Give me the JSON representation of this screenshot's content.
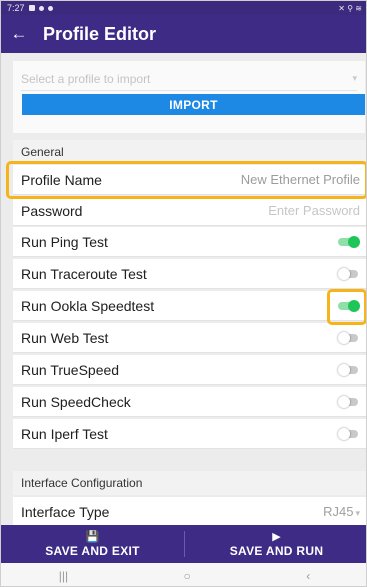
{
  "status_bar": {
    "time": "7:27",
    "right_icons": "✕ ⚲ ≋"
  },
  "app_bar": {
    "back_icon": "←",
    "title": "Profile Editor"
  },
  "import": {
    "placeholder": "Select a profile to import",
    "caret": "▾",
    "button": "IMPORT"
  },
  "general": {
    "header": "General",
    "profile_name": {
      "label": "Profile Name",
      "value": "New Ethernet Profile"
    },
    "password": {
      "label": "Password",
      "placeholder": "Enter Password"
    },
    "toggles": [
      {
        "label": "Run Ping Test",
        "on": true
      },
      {
        "label": "Run Traceroute Test",
        "on": false
      },
      {
        "label": "Run Ookla Speedtest",
        "on": true
      },
      {
        "label": "Run Web Test",
        "on": false
      },
      {
        "label": "Run TrueSpeed",
        "on": false
      },
      {
        "label": "Run SpeedCheck",
        "on": false
      },
      {
        "label": "Run Iperf Test",
        "on": false
      }
    ]
  },
  "interface": {
    "header": "Interface Configuration",
    "type_label": "Interface Type",
    "type_value": "RJ45",
    "type_caret": "▾"
  },
  "actions": {
    "save_exit": {
      "icon": "💾",
      "label": "SAVE AND EXIT"
    },
    "save_run": {
      "icon": "▶",
      "label": "SAVE AND RUN"
    }
  },
  "nav": {
    "recents": "|||",
    "home": "○",
    "back": "‹"
  },
  "colors": {
    "primary": "#3d2b86",
    "accent": "#1e88e5",
    "toggle_on": "#1fc557",
    "highlight": "#f4b41a"
  }
}
